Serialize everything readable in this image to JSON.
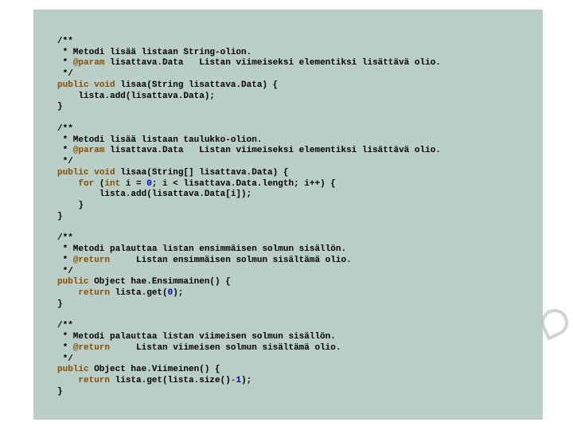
{
  "code": {
    "block1": {
      "c1": "/**",
      "c2": " * Metodi lisää listaan String-olion.",
      "c3a": " * ",
      "c3b": "@param",
      "c3c": " lisattava.Data   Listan viimeiseksi elementiksi lisättävä olio.",
      "c4": " */",
      "sig_a": "public",
      "sig_b": " ",
      "sig_c": "void",
      "sig_d": " lisaa(String lisattava.Data) {",
      "body": "    lista.add(lisattava.Data);",
      "close": "}"
    },
    "block2": {
      "c1": "/**",
      "c2": " * Metodi lisää listaan taulukko-olion.",
      "c3a": " * ",
      "c3b": "@param",
      "c3c": " lisattava.Data   Listan viimeiseksi elementiksi lisättävä olio.",
      "c4": " */",
      "sig_a": "public",
      "sig_b": " ",
      "sig_c": "void",
      "sig_d": " lisaa(String[] lisattava.Data) {",
      "for_a": "    ",
      "for_b": "for",
      "for_c": " (",
      "for_d": "int",
      "for_e": " i = ",
      "for_f": "0",
      "for_g": "; i < lisattava.Data.length; i++) {",
      "body": "        lista.add(lisattava.Data[i]);",
      "close1": "    }",
      "close2": "}"
    },
    "block3": {
      "c1": "/**",
      "c2": " * Metodi palauttaa listan ensimmäisen solmun sisällön.",
      "c3a": " * ",
      "c3b": "@return",
      "c3c": "     Listan ensimmäisen solmun sisältämä olio.",
      "c4": " */",
      "sig_a": "public",
      "sig_b": " Object hae.Ensimmainen() {",
      "ret_a": "    ",
      "ret_b": "return",
      "ret_c": " lista.get(",
      "ret_d": "0",
      "ret_e": ");",
      "close": "}"
    },
    "block4": {
      "c1": "/**",
      "c2": " * Metodi palauttaa listan viimeisen solmun sisällön.",
      "c3a": " * ",
      "c3b": "@return",
      "c3c": "     Listan viimeisen solmun sisältämä olio.",
      "c4": " */",
      "sig_a": "public",
      "sig_b": " Object hae.Viimeinen() {",
      "ret_a": "    ",
      "ret_b": "return",
      "ret_c": " lista.get(lista.size()",
      "ret_d": "-",
      "ret_e": "1",
      "ret_f": ");",
      "close": "}"
    }
  }
}
